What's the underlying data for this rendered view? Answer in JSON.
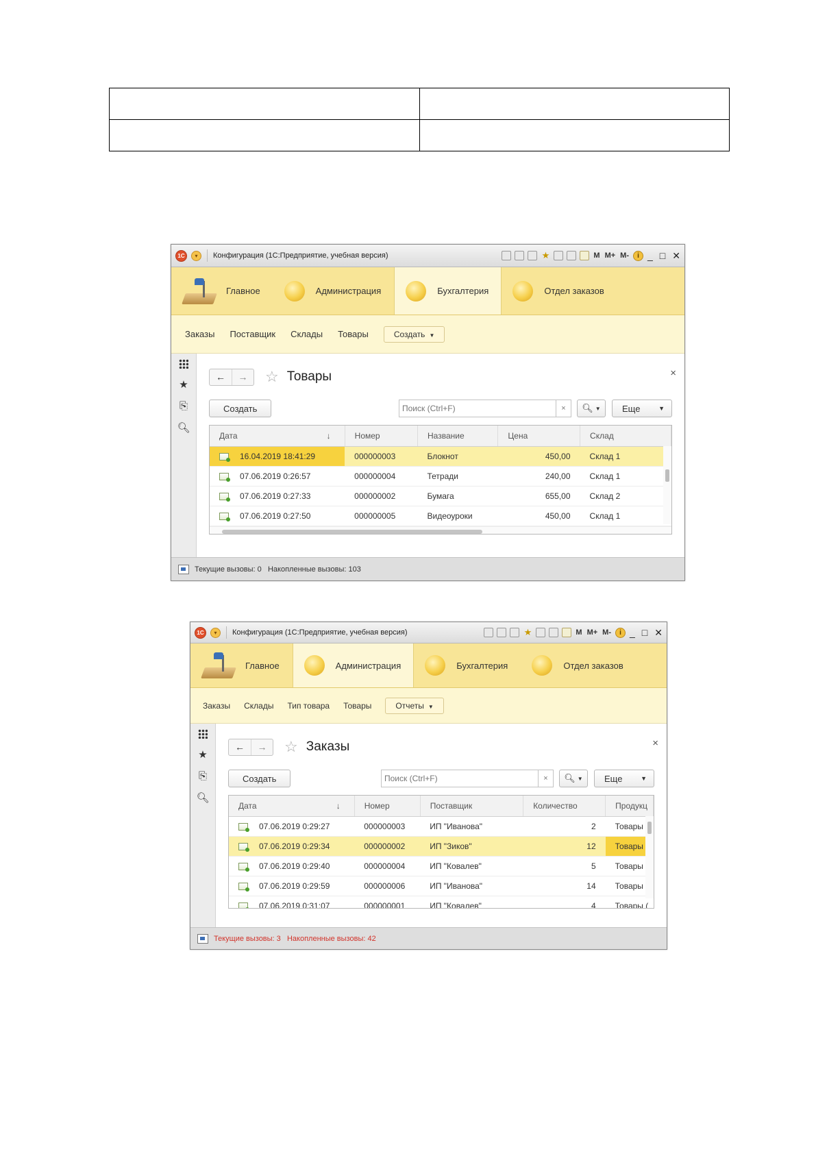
{
  "doc_table": {
    "rows": [
      [
        "",
        ""
      ],
      [
        "",
        ""
      ]
    ]
  },
  "windows": [
    {
      "title": "Конфигурация  (1С:Предприятие, учебная версия)",
      "toolbar": {
        "m": "M",
        "mplus": "M+",
        "mminus": "M-",
        "info": "i",
        "minimize": "_",
        "maximize": "□",
        "close": "✕"
      },
      "sections": [
        {
          "label": "Главное",
          "icon": "desk-icon",
          "active": false
        },
        {
          "label": "Администрация",
          "icon": "section-icon",
          "active": false
        },
        {
          "label": "Бухгалтерия",
          "icon": "section-icon",
          "active": true
        },
        {
          "label": "Отдел заказов",
          "icon": "section-icon",
          "active": false
        }
      ],
      "commands": [
        "Заказы",
        "Поставщик",
        "Склады",
        "Товары"
      ],
      "commands_button": "Создать",
      "form": {
        "title": "Товары",
        "create_label": "Создать",
        "search_placeholder": "Поиск (Ctrl+F)",
        "more_label": "Еще",
        "columns": [
          "Дата",
          "Номер",
          "Название",
          "Цена",
          "Склад"
        ],
        "rows": [
          [
            "16.04.2019 18:41:29",
            "000000003",
            "Блокнот",
            "450,00",
            "Склад 1"
          ],
          [
            "07.06.2019 0:26:57",
            "000000004",
            "Тетради",
            "240,00",
            "Склад 1"
          ],
          [
            "07.06.2019 0:27:33",
            "000000002",
            "Бумага",
            "655,00",
            "Склад 2"
          ],
          [
            "07.06.2019 0:27:50",
            "000000005",
            "Видеоуроки",
            "450,00",
            "Склад 1"
          ]
        ],
        "selected_row": 0
      },
      "status": {
        "current": "Текущие вызовы: 0",
        "accumulated": "Накопленные вызовы: 103",
        "alert": false
      }
    },
    {
      "title": "Конфигурация  (1С:Предприятие, учебная версия)",
      "toolbar": {
        "m": "M",
        "mplus": "M+",
        "mminus": "M-",
        "info": "i",
        "minimize": "_",
        "maximize": "□",
        "close": "✕"
      },
      "sections": [
        {
          "label": "Главное",
          "icon": "desk-icon",
          "active": false
        },
        {
          "label": "Администрация",
          "icon": "section-icon",
          "active": true
        },
        {
          "label": "Бухгалтерия",
          "icon": "section-icon",
          "active": false
        },
        {
          "label": "Отдел заказов",
          "icon": "section-icon",
          "active": false
        }
      ],
      "commands": [
        "Заказы",
        "Склады",
        "Тип товара",
        "Товары"
      ],
      "commands_button": "Отчеты",
      "form": {
        "title": "Заказы",
        "create_label": "Создать",
        "search_placeholder": "Поиск (Ctrl+F)",
        "more_label": "Еще",
        "columns": [
          "Дата",
          "Номер",
          "Поставщик",
          "Количество",
          "Продукц"
        ],
        "rows": [
          [
            "07.06.2019 0:29:27",
            "000000003",
            "ИП \"Иванова\"",
            "2",
            "Товары ("
          ],
          [
            "07.06.2019 0:29:34",
            "000000002",
            "ИП \"Зиков\"",
            "12",
            "Товары ("
          ],
          [
            "07.06.2019 0:29:40",
            "000000004",
            "ИП \"Ковалев\"",
            "5",
            "Товары ("
          ],
          [
            "07.06.2019 0:29:59",
            "000000006",
            "ИП \"Иванова\"",
            "14",
            "Товары ("
          ],
          [
            "07.06.2019 0:31:07",
            "000000001",
            "ИП \"Ковалев\"",
            "4",
            "Товары ("
          ]
        ],
        "selected_row": 1
      },
      "status": {
        "current": "Текущие вызовы: 3",
        "accumulated": "Накопленные вызовы: 42",
        "alert": true
      }
    }
  ]
}
